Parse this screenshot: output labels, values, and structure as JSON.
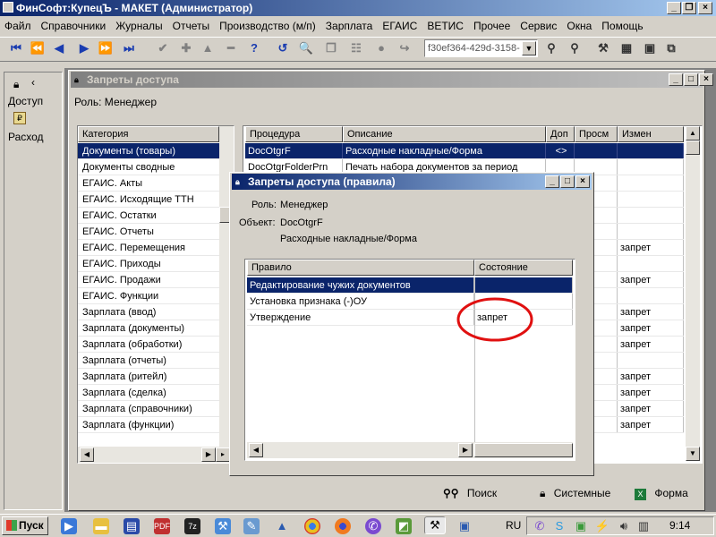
{
  "app": {
    "title": "ФинСофт:КупецЪ - МАКЕТ  (Администратор)",
    "menu": [
      "Файл",
      "Справочники",
      "Журналы",
      "Отчеты",
      "Производство (м/п)",
      "Зарплата",
      "ЕГАИС",
      "ВЕТИС",
      "Прочее",
      "Сервис",
      "Окна",
      "Помощь"
    ],
    "combo_value": "f30ef364-429d-3158-"
  },
  "left_panel": {
    "item1_label": "Доступ",
    "item2_label": "Расход"
  },
  "main_window": {
    "title": "Запреты доступа",
    "role_label": "Роль: Менеджер",
    "categories_header": "Категория",
    "categories": [
      "Документы (товары)",
      "Документы сводные",
      "ЕГАИС. Акты",
      "ЕГАИС. Исходящие ТТН",
      "ЕГАИС. Остатки",
      "ЕГАИС. Отчеты",
      "ЕГАИС. Перемещения",
      "ЕГАИС. Приходы",
      "ЕГАИС. Продажи",
      "ЕГАИС. Функции",
      "Зарплата (ввод)",
      "Зарплата (документы)",
      "Зарплата (обработки)",
      "Зарплата (отчеты)",
      "Зарплата (ритейл)",
      "Зарплата (сделка)",
      "Зарплата (справочники)",
      "Зарплата (функции)"
    ],
    "proc_headers": {
      "procedure": "Процедура",
      "description": "Описание",
      "dop": "Доп",
      "prosm": "Просм",
      "izmen": "Измен"
    },
    "proc_rows": [
      {
        "procedure": "DocOtgrF",
        "description": "Расходные накладные/Форма",
        "dop": "<>",
        "prosm": "",
        "izmen": ""
      },
      {
        "procedure": "DocOtgrFolderPrn",
        "description": "Печать набора документов за период",
        "dop": "",
        "prosm": "",
        "izmen": ""
      },
      {
        "procedure": "",
        "description": "",
        "dop": "",
        "prosm": "",
        "izmen": ""
      },
      {
        "procedure": "",
        "description": "",
        "dop": "",
        "prosm": "",
        "izmen": ""
      },
      {
        "procedure": "",
        "description": "",
        "dop": "",
        "prosm": "",
        "izmen": ""
      },
      {
        "procedure": "",
        "description": "",
        "dop": "",
        "prosm": "",
        "izmen": ""
      },
      {
        "procedure": "",
        "description": "",
        "dop": "",
        "prosm": "",
        "izmen": "запрет"
      },
      {
        "procedure": "",
        "description": "",
        "dop": "",
        "prosm": "",
        "izmen": ""
      },
      {
        "procedure": "",
        "description": "",
        "dop": "",
        "prosm": "",
        "izmen": "запрет"
      },
      {
        "procedure": "",
        "description": "",
        "dop": "",
        "prosm": "",
        "izmen": ""
      },
      {
        "procedure": "",
        "description": "",
        "dop": "",
        "prosm": "",
        "izmen": "запрет"
      },
      {
        "procedure": "",
        "description": "",
        "dop": "",
        "prosm": "",
        "izmen": "запрет"
      },
      {
        "procedure": "",
        "description": "",
        "dop": "",
        "prosm": "",
        "izmen": "запрет"
      },
      {
        "procedure": "",
        "description": "",
        "dop": "",
        "prosm": "",
        "izmen": ""
      },
      {
        "procedure": "",
        "description": "",
        "dop": "",
        "prosm": "",
        "izmen": "запрет"
      },
      {
        "procedure": "",
        "description": "",
        "dop": "",
        "prosm": "",
        "izmen": "запрет"
      },
      {
        "procedure": "",
        "description": "",
        "dop": "",
        "prosm": "",
        "izmen": "запрет"
      },
      {
        "procedure": "",
        "description": "",
        "dop": "",
        "prosm": "",
        "izmen": "запрет"
      }
    ],
    "buttons": {
      "search": "Поиск",
      "system": "Системные",
      "form": "Форма"
    }
  },
  "dialog": {
    "title": "Запреты доступа (правила)",
    "role_label": "Роль:",
    "role_value": "Менеджер",
    "object_label": "Объект:",
    "object_code": "DocOtgrF",
    "object_name": "Расходные накладные/Форма",
    "headers": {
      "rule": "Правило",
      "state": "Состояние"
    },
    "rows": [
      {
        "rule": "Редактирование чужих документов",
        "state": ""
      },
      {
        "rule": "Установка признака (-)ОУ",
        "state": ""
      },
      {
        "rule": "Утверждение",
        "state": "запрет"
      }
    ]
  },
  "taskbar": {
    "start_label": "Пуск",
    "lang": "RU",
    "time": "9:14"
  },
  "colors": {
    "selection": "#0a246a",
    "highlight_circle": "#e01010"
  }
}
